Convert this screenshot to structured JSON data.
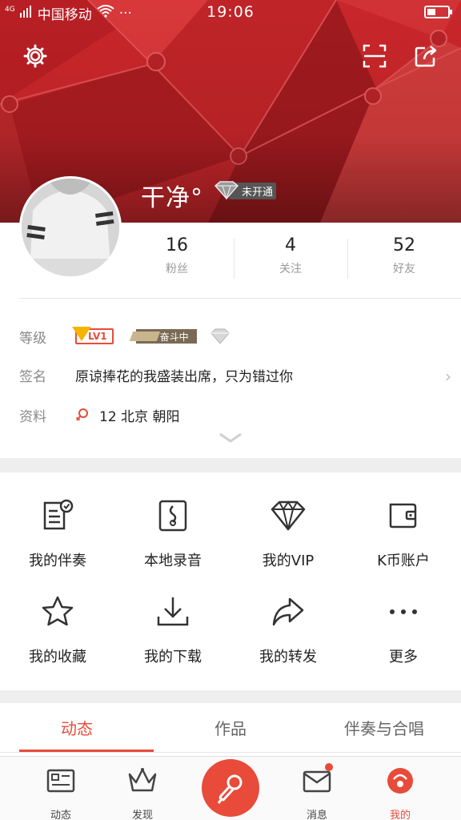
{
  "status_bar": {
    "network": "4G",
    "carrier": "中国移动",
    "time": "19:06",
    "more": "···"
  },
  "profile": {
    "username": "干净°",
    "vip_status": "未开通",
    "stats": [
      {
        "value": "16",
        "label": "粉丝"
      },
      {
        "value": "4",
        "label": "关注"
      },
      {
        "value": "52",
        "label": "好友"
      }
    ]
  },
  "info": {
    "level_key": "等级",
    "level_value": "LV1",
    "struggle_label": "奋斗中",
    "signature_key": "签名",
    "signature_value": "原谅捧花的我盛装出席，只为错过你",
    "profile_key": "资料",
    "profile_value": "12 北京 朝阳"
  },
  "grid": [
    {
      "label": "我的伴奏",
      "icon": "accompaniment-icon"
    },
    {
      "label": "本地录音",
      "icon": "local-recording-icon"
    },
    {
      "label": "我的VIP",
      "icon": "vip-diamond-icon"
    },
    {
      "label": "K币账户",
      "icon": "wallet-icon"
    },
    {
      "label": "我的收藏",
      "icon": "star-icon"
    },
    {
      "label": "我的下载",
      "icon": "download-icon"
    },
    {
      "label": "我的转发",
      "icon": "forward-icon"
    },
    {
      "label": "更多",
      "icon": "more-icon"
    }
  ],
  "tabs": [
    {
      "label": "动态",
      "active": true
    },
    {
      "label": "作品",
      "active": false
    },
    {
      "label": "伴奏与合唱",
      "active": false
    }
  ],
  "bottom_nav": [
    {
      "label": "动态",
      "icon": "feed-icon"
    },
    {
      "label": "发现",
      "icon": "crown-icon"
    },
    {
      "label": "消息",
      "icon": "message-icon"
    },
    {
      "label": "我的",
      "icon": "me-icon"
    }
  ],
  "colors": {
    "accent": "#e84b3a",
    "header_red": "#c8262a"
  }
}
